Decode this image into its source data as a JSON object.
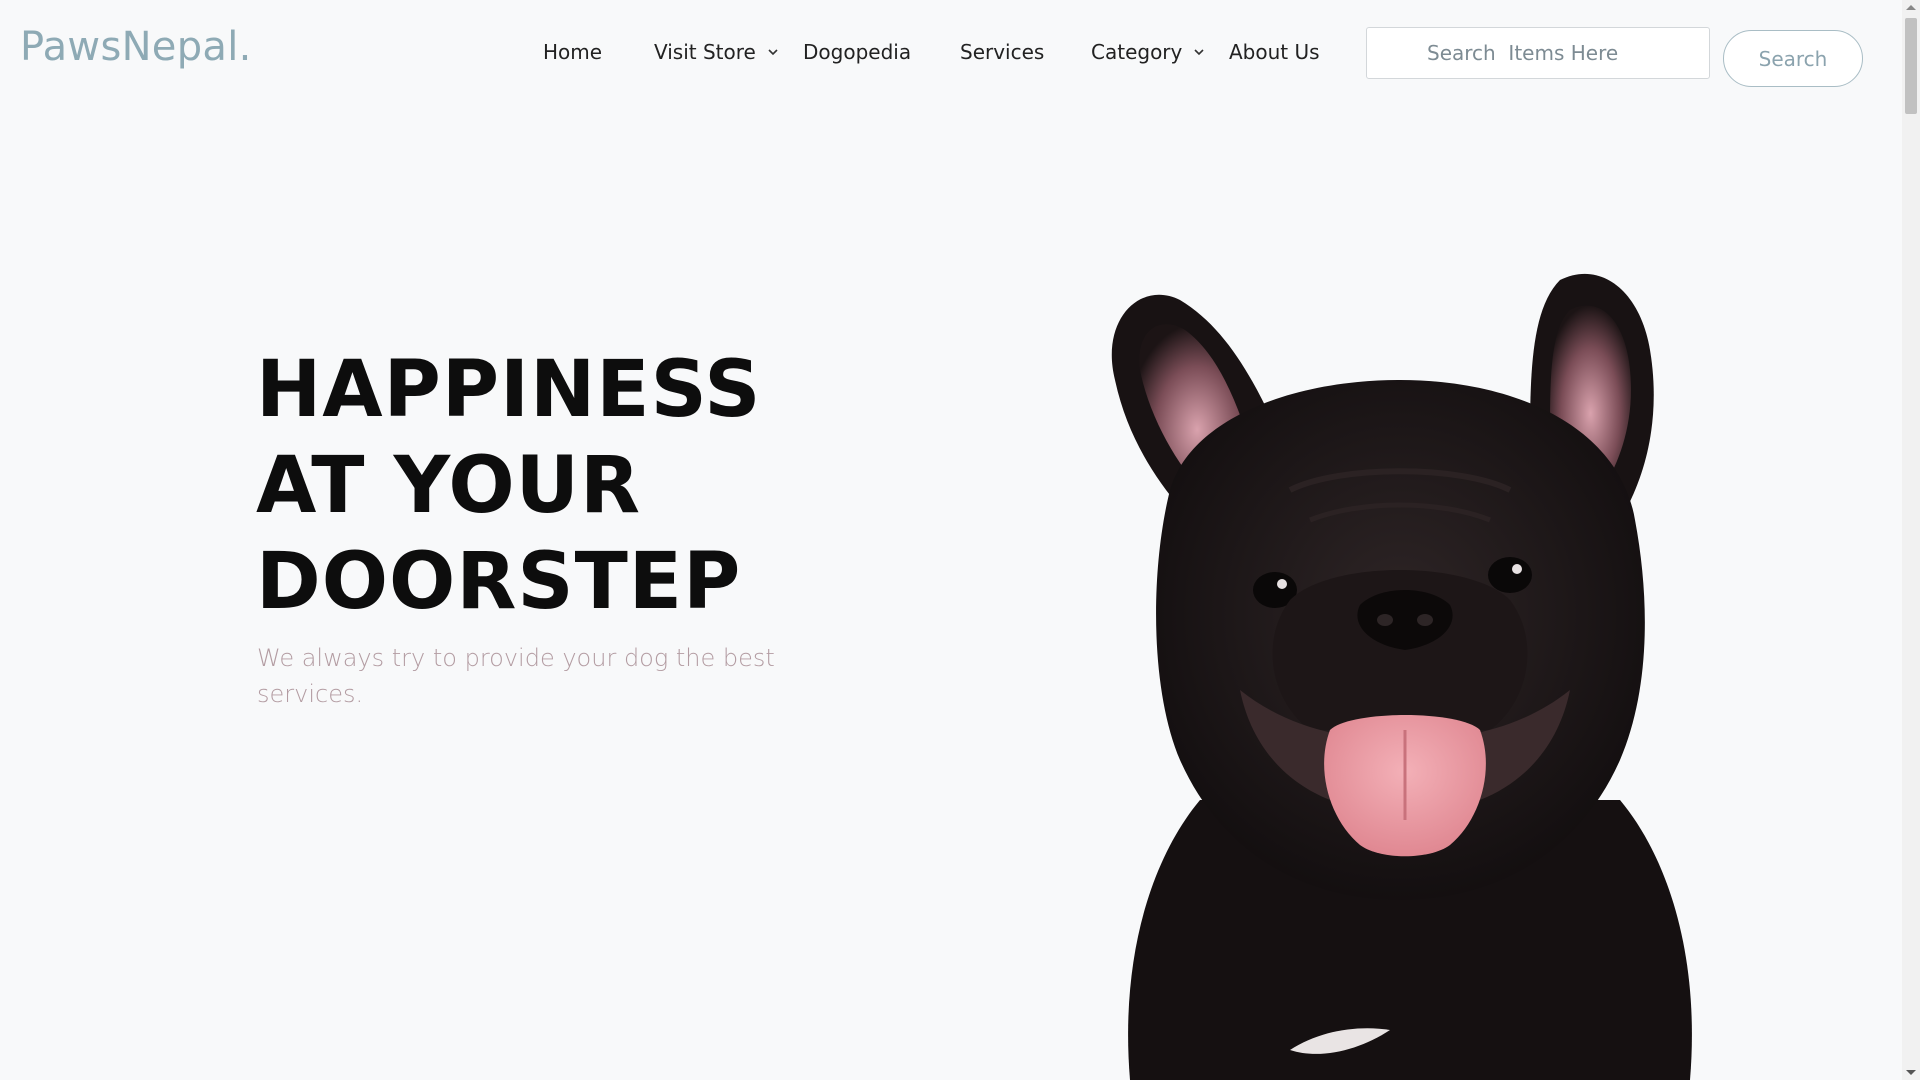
{
  "header": {
    "logo": "PawsNepal.",
    "nav": [
      {
        "label": "Home",
        "has_dropdown": false
      },
      {
        "label": "Visit Store",
        "has_dropdown": true
      },
      {
        "label": "Dogopedia",
        "has_dropdown": false
      },
      {
        "label": "Services",
        "has_dropdown": false
      },
      {
        "label": "Category",
        "has_dropdown": true
      },
      {
        "label": "About Us",
        "has_dropdown": false
      }
    ],
    "search": {
      "placeholder": "Search  Items Here",
      "value": "",
      "button_label": "Search"
    }
  },
  "hero": {
    "title_lines": [
      "HAPPINESS",
      "AT YOUR",
      "DOORSTEP"
    ],
    "subtitle": "We always try to provide your dog the best services."
  },
  "icons": {
    "dropdown": "chevron-down-icon",
    "image": "french-bulldog-photo"
  },
  "colors": {
    "background": "#f8f9fa",
    "logo": "#8eaab5",
    "title": "#0d0d0d",
    "subtitle": "#b39ca2",
    "search_button_border": "#a9bdc5"
  }
}
